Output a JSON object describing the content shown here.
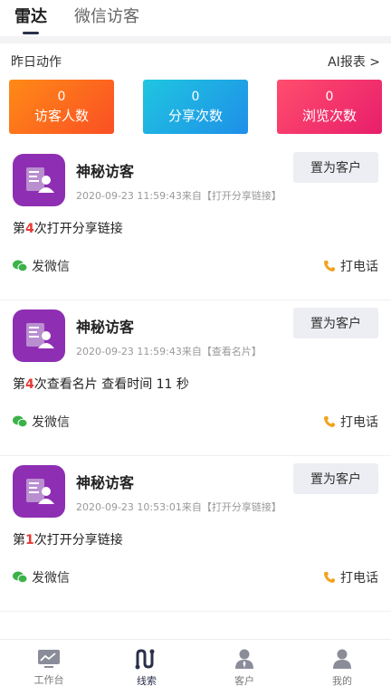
{
  "tabs": [
    {
      "label": "雷达",
      "active": true
    },
    {
      "label": "微信访客",
      "active": false
    }
  ],
  "summary": {
    "title": "昨日动作",
    "report_link": "AI报表 >",
    "stats": [
      {
        "value": "0",
        "label": "访客人数",
        "color": "#fa6a1f"
      },
      {
        "value": "0",
        "label": "分享次数",
        "color": "#1fa8e4"
      },
      {
        "value": "0",
        "label": "浏览次数",
        "color": "#f0325f"
      }
    ]
  },
  "feed": [
    {
      "name": "神秘访客",
      "meta": "2020-09-23 11:59:43来自【打开分享链接】",
      "button": "置为客户",
      "action_prefix": "第",
      "action_count": "4",
      "action_suffix": "次打开分享链接",
      "wechat": "发微信",
      "call": "打电话"
    },
    {
      "name": "神秘访客",
      "meta": "2020-09-23 11:59:43来自【查看名片】",
      "button": "置为客户",
      "action_prefix": "第",
      "action_count": "4",
      "action_suffix": "次查看名片 查看时间 11 秒",
      "wechat": "发微信",
      "call": "打电话"
    },
    {
      "name": "神秘访客",
      "meta": "2020-09-23 10:53:01来自【打开分享链接】",
      "button": "置为客户",
      "action_prefix": "第",
      "action_count": "1",
      "action_suffix": "次打开分享链接",
      "wechat": "发微信",
      "call": "打电话"
    }
  ],
  "nav": [
    {
      "label": "工作台",
      "icon": "monitor-chart-icon",
      "active": false
    },
    {
      "label": "线索",
      "icon": "route-icon",
      "active": true
    },
    {
      "label": "客户",
      "icon": "user-tie-icon",
      "active": false
    },
    {
      "label": "我的",
      "icon": "user-icon",
      "active": false
    }
  ],
  "colors": {
    "accent": "#2a2f4a",
    "avatar_bg": "#8e2fb3",
    "count_red": "#e53935",
    "wechat_green": "#3bb24a",
    "phone_orange": "#f2a21b"
  }
}
